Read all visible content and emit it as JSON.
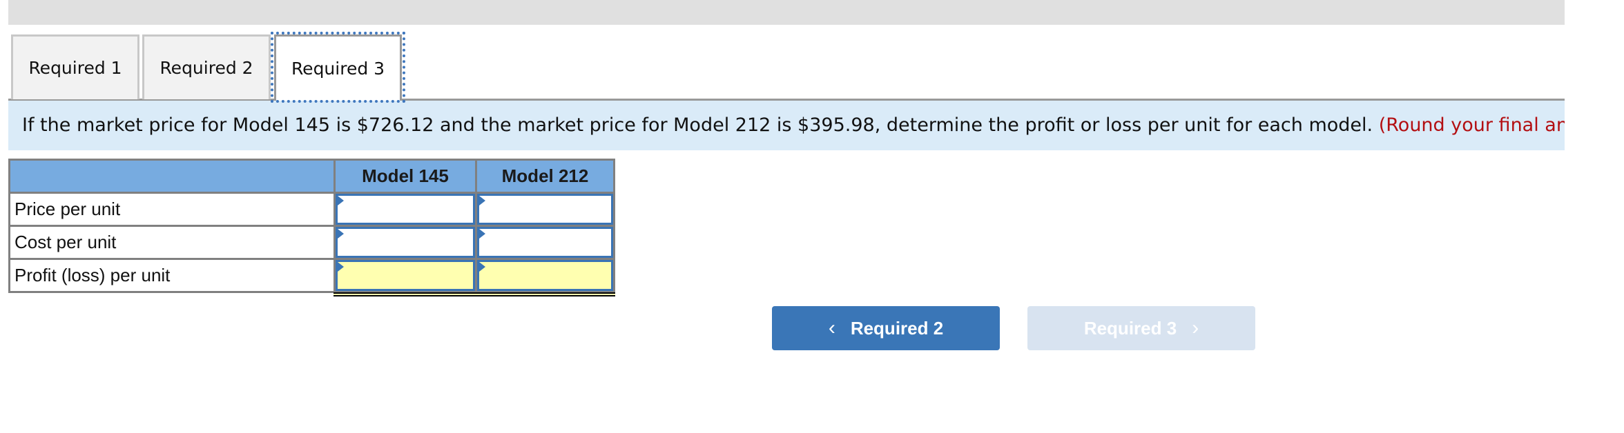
{
  "tabs": [
    {
      "label": "Required 1",
      "active": false
    },
    {
      "label": "Required 2",
      "active": false
    },
    {
      "label": "Required 3",
      "active": true
    }
  ],
  "prompt": {
    "text": "If the market price for Model 145 is $726.12 and the market price for Model 212 is $395.98, determine the profit or loss per unit for each model.",
    "note": "(Round your final answe"
  },
  "table": {
    "headers": [
      "",
      "Model 145",
      "Model 212"
    ],
    "rows": [
      {
        "label": "Price per unit",
        "values": [
          "",
          ""
        ]
      },
      {
        "label": "Cost per unit",
        "values": [
          "",
          ""
        ]
      },
      {
        "label": "Profit (loss) per unit",
        "values": [
          "",
          ""
        ]
      }
    ]
  },
  "nav": {
    "prev_label": "Required 2",
    "prev_icon": "chevron-left-icon",
    "prev_glyph": "‹",
    "next_label": "Required 3",
    "next_icon": "chevron-right-icon",
    "next_glyph": "›"
  },
  "colors": {
    "accent": "#3a76b7",
    "header_bg": "#77abe0",
    "prompt_bg": "#daebf8",
    "note_red": "#b30f12",
    "total_fill": "#ffffb0",
    "disabled_btn": "#d8e3f0"
  }
}
